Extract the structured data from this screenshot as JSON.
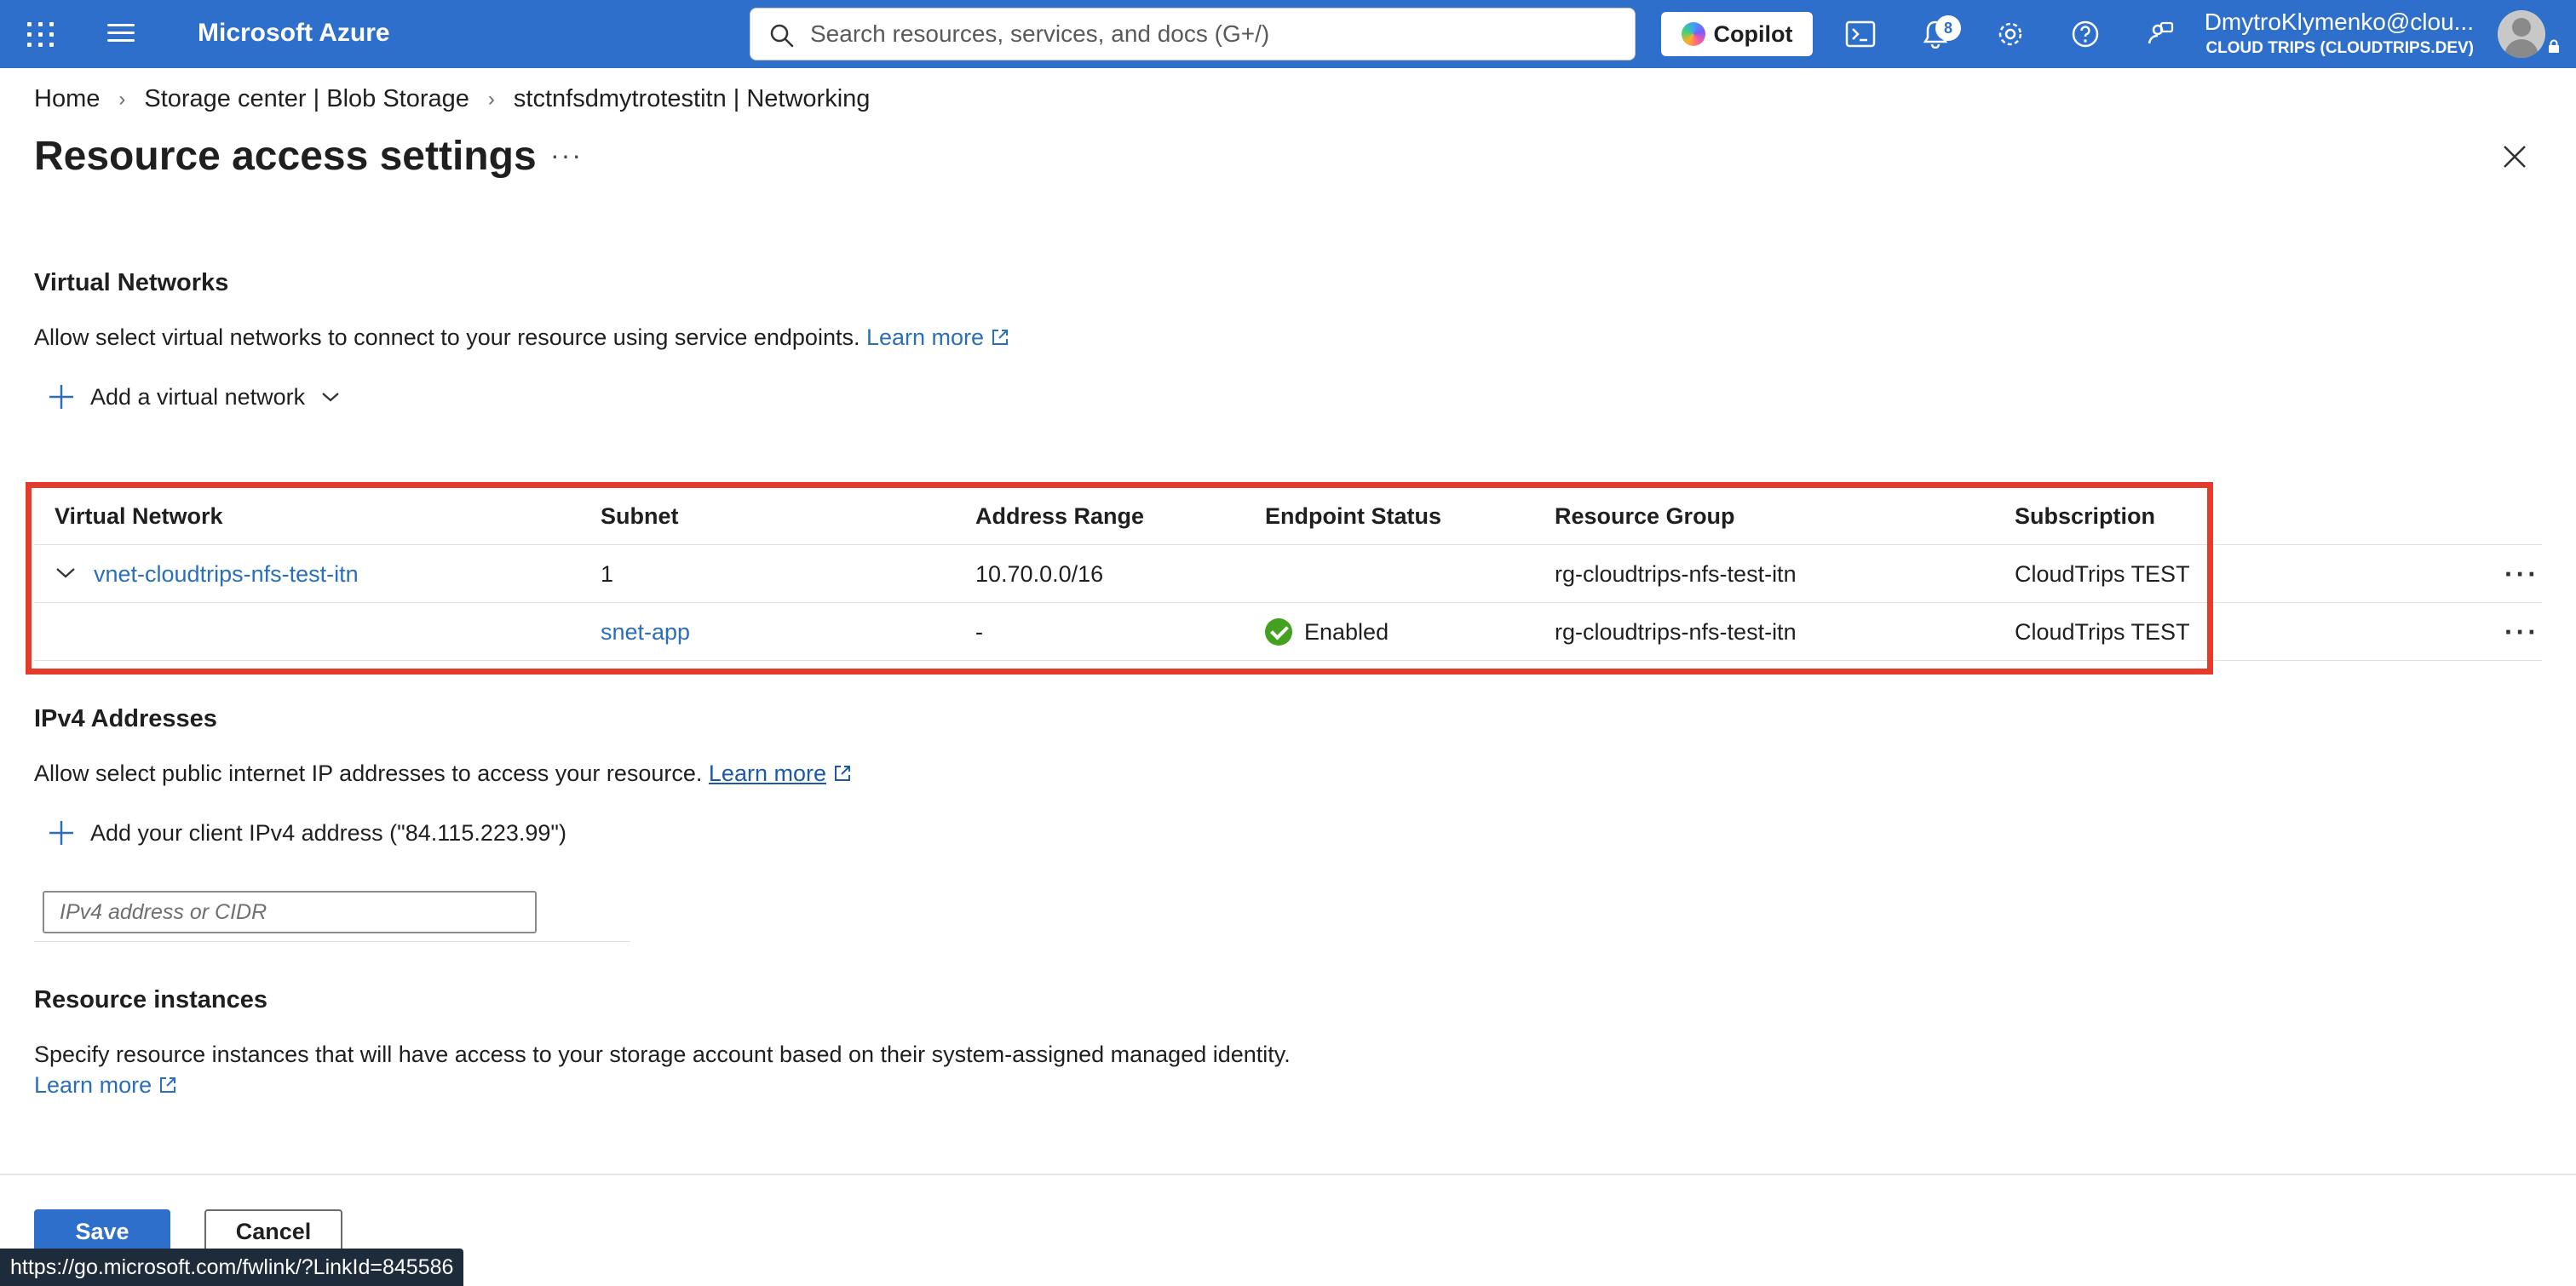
{
  "topbar": {
    "brand": "Microsoft Azure",
    "search_placeholder": "Search resources, services, and docs (G+/)",
    "copilot_label": "Copilot",
    "notification_count": "8",
    "account_name": "DmytroKlymenko@clou...",
    "account_tenant": "CLOUD TRIPS (CLOUDTRIPS.DEV)",
    "color": "#2f6fcc"
  },
  "breadcrumb": [
    "Home",
    "Storage center | Blob Storage",
    "stctnfsdmytrotestitn | Networking"
  ],
  "page": {
    "title": "Resource access settings",
    "more": "···"
  },
  "virtual_networks": {
    "heading": "Virtual Networks",
    "description": "Allow select virtual networks to connect to your resource using service endpoints.",
    "learn_more": "Learn more",
    "add_label": "Add a virtual network",
    "columns": [
      "Virtual Network",
      "Subnet",
      "Address Range",
      "Endpoint Status",
      "Resource Group",
      "Subscription"
    ],
    "rows": [
      {
        "virtual_network": "vnet-cloudtrips-nfs-test-itn",
        "subnet": "1",
        "address_range": "10.70.0.0/16",
        "endpoint_status": "",
        "resource_group": "rg-cloudtrips-nfs-test-itn",
        "subscription": "CloudTrips TEST"
      },
      {
        "virtual_network": "",
        "subnet": "snet-app",
        "address_range": "-",
        "endpoint_status": "Enabled",
        "resource_group": "rg-cloudtrips-nfs-test-itn",
        "subscription": "CloudTrips TEST"
      }
    ],
    "row_more": "···"
  },
  "ipv4": {
    "heading": "IPv4 Addresses",
    "description": "Allow select public internet IP addresses to access your resource.",
    "learn_more": "Learn more",
    "add_label": "Add your client IPv4 address (\"84.115.223.99\")",
    "input_placeholder": "IPv4 address or CIDR"
  },
  "resource_instances": {
    "heading": "Resource instances",
    "description": "Specify resource instances that will have access to your storage account based on their system-assigned managed identity.",
    "learn_more_1": "Learn",
    "learn_more_2": "more"
  },
  "footer": {
    "save_label": "Save",
    "cancel_label": "Cancel",
    "status_url": "https://go.microsoft.com/fwlink/?LinkId=845586"
  }
}
